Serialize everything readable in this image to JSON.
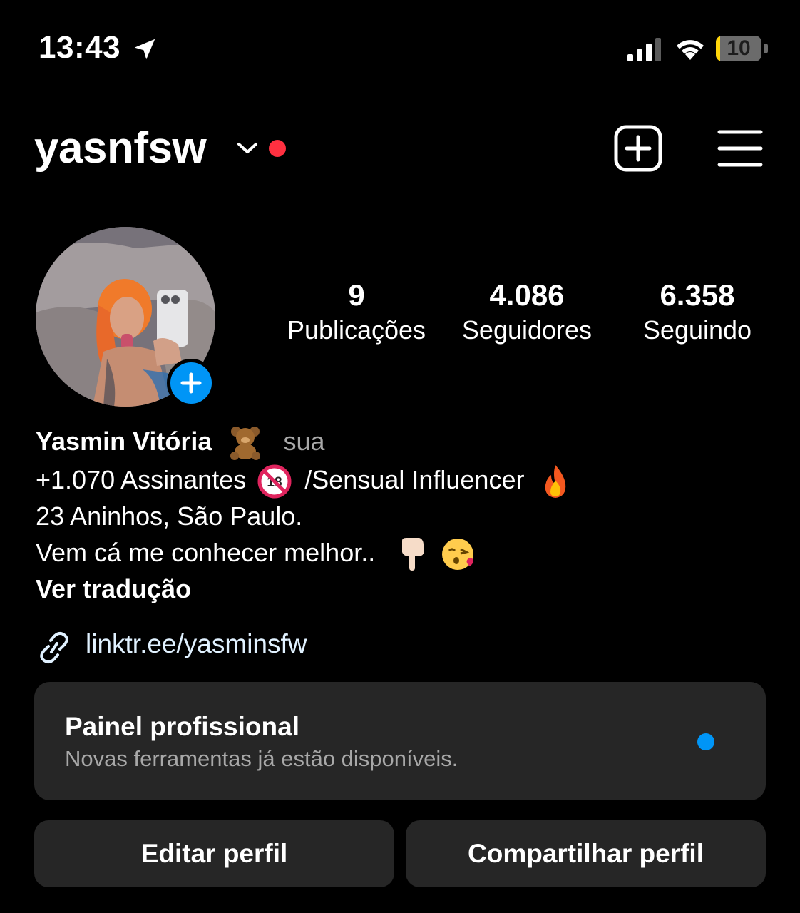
{
  "status_bar": {
    "time": "13:43",
    "battery_level": "10",
    "battery_fraction": 0.1,
    "icons": [
      "location-arrow-icon",
      "cellular-signal-icon",
      "wifi-icon",
      "battery-icon"
    ]
  },
  "header": {
    "username": "yasnfsw",
    "icons": [
      "chevron-down-icon",
      "new-post-icon",
      "menu-icon"
    ],
    "notification_color": "#ff3040"
  },
  "stats": [
    {
      "value": "9",
      "label": "Publicações"
    },
    {
      "value": "4.086",
      "label": "Seguidores"
    },
    {
      "value": "6.358",
      "label": "Seguindo"
    }
  ],
  "bio": {
    "name": "Yasmin Vitória",
    "name_emoji": "teddy-bear",
    "pronoun": "sua",
    "line1": "+1.070 Assinantes",
    "line1_emoji": "no-one-under-18",
    "line1_rest": "/Sensual Influencer",
    "line1_end_emoji": "fire",
    "line2": "23 Aninhos, São Paulo.",
    "line3": "Vem cá me conhecer melhor..",
    "line3_emojis": [
      "pointing-down",
      "face-blowing-kiss"
    ],
    "see_translation": "Ver tradução",
    "link": "linktr.ee/yasminsfw"
  },
  "dashboard": {
    "title": "Painel profissional",
    "subtitle": "Novas ferramentas já estão disponíveis.",
    "dot_color": "#0095f6"
  },
  "buttons": {
    "edit": "Editar perfil",
    "share": "Compartilhar perfil"
  },
  "colors": {
    "background": "#000000",
    "card": "#262626",
    "accent_blue": "#0095f6",
    "secondary_text": "#a8a8a8"
  }
}
